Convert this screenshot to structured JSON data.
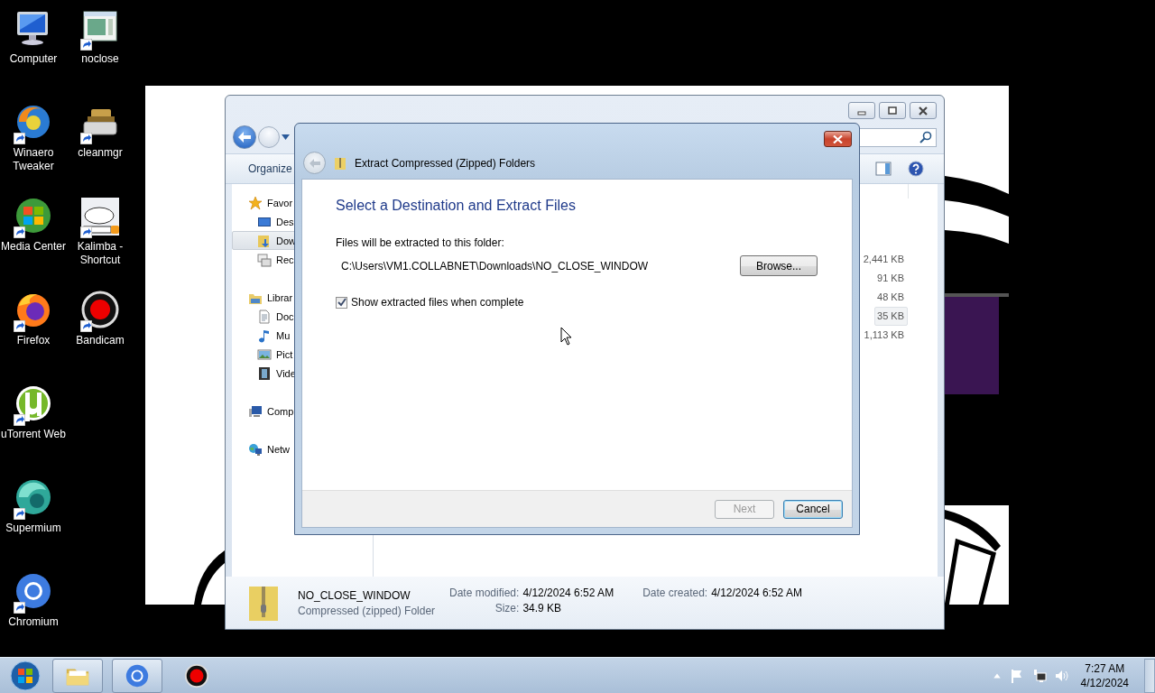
{
  "desktop": {
    "icon_columns": [
      [
        {
          "label": "Computer",
          "kind": "computer",
          "shortcut": false
        },
        {
          "label": "Winaero Tweaker",
          "kind": "winaero",
          "shortcut": true
        },
        {
          "label": "Media Center",
          "kind": "mediacenter",
          "shortcut": true
        },
        {
          "label": "Firefox",
          "kind": "firefox",
          "shortcut": true
        },
        {
          "label": "uTorrent Web",
          "kind": "utorrent",
          "shortcut": true
        },
        {
          "label": "Supermium",
          "kind": "supermium",
          "shortcut": true
        },
        {
          "label": "Chromium",
          "kind": "chromium",
          "shortcut": true
        }
      ],
      [
        {
          "label": "noclose",
          "kind": "noclose",
          "shortcut": true
        },
        {
          "label": "cleanmgr",
          "kind": "cleanmgr",
          "shortcut": true
        },
        {
          "label": "Kalimba - Shortcut",
          "kind": "kalimba",
          "shortcut": true
        },
        {
          "label": "Bandicam",
          "kind": "bandicam",
          "shortcut": true
        }
      ]
    ]
  },
  "explorer": {
    "toolbar": {
      "organize": "Organize"
    },
    "nav_items": [
      {
        "label": "Favor",
        "kind": "favorites",
        "selected": false,
        "children": [
          {
            "label": "Des",
            "kind": "desktop",
            "selected": false
          },
          {
            "label": "Dow",
            "kind": "downloads",
            "selected": true
          },
          {
            "label": "Rec",
            "kind": "recent",
            "selected": false
          }
        ]
      },
      {
        "label": "Librar",
        "kind": "libraries",
        "selected": false,
        "children": [
          {
            "label": "Doc",
            "kind": "documents",
            "selected": false
          },
          {
            "label": "Mu",
            "kind": "music",
            "selected": false
          },
          {
            "label": "Pict",
            "kind": "pictures",
            "selected": false
          },
          {
            "label": "Vide",
            "kind": "videos",
            "selected": false
          }
        ]
      },
      {
        "label": "Comp",
        "kind": "computer",
        "selected": false
      },
      {
        "label": "Netw",
        "kind": "network",
        "selected": false
      }
    ],
    "rows": [
      {
        "column_1": "2,441 KB",
        "selected": false
      },
      {
        "column_1": "91 KB",
        "selected": false
      },
      {
        "column_1": "48 KB",
        "selected": false
      },
      {
        "column_1": "35 KB",
        "selected": true
      },
      {
        "column_1": "1,113 KB",
        "selected": false
      }
    ],
    "details": {
      "name": "NO_CLOSE_WINDOW",
      "type": "Compressed (zipped) Folder",
      "property_groups": [
        [
          {
            "label": "Date modified:",
            "value": "4/12/2024 6:52 AM"
          },
          {
            "label": "Size:",
            "value": "34.9 KB"
          }
        ],
        [
          {
            "label": "Date created:",
            "value": "4/12/2024 6:52 AM"
          }
        ]
      ]
    }
  },
  "dialog": {
    "title": "Extract Compressed (Zipped) Folders",
    "heading": "Select a Destination and Extract Files",
    "folder_label": "Files will be extracted to this folder:",
    "path": "C:\\Users\\VM1.COLLABNET\\Downloads\\NO_CLOSE_WINDOW",
    "browse_button": "Browse...",
    "checkbox": {
      "label": "Show extracted files when complete",
      "checked": true
    },
    "buttons": [
      {
        "label": "Next",
        "disabled": true
      },
      {
        "label": "Cancel",
        "disabled": false
      }
    ]
  },
  "taskbar": {
    "items": [
      {
        "kind": "explorer",
        "active": true
      },
      {
        "kind": "chromium",
        "active": true
      },
      {
        "kind": "bandicam",
        "active": false
      }
    ],
    "clock": {
      "time": "7:27 AM",
      "date": "4/12/2024"
    }
  }
}
